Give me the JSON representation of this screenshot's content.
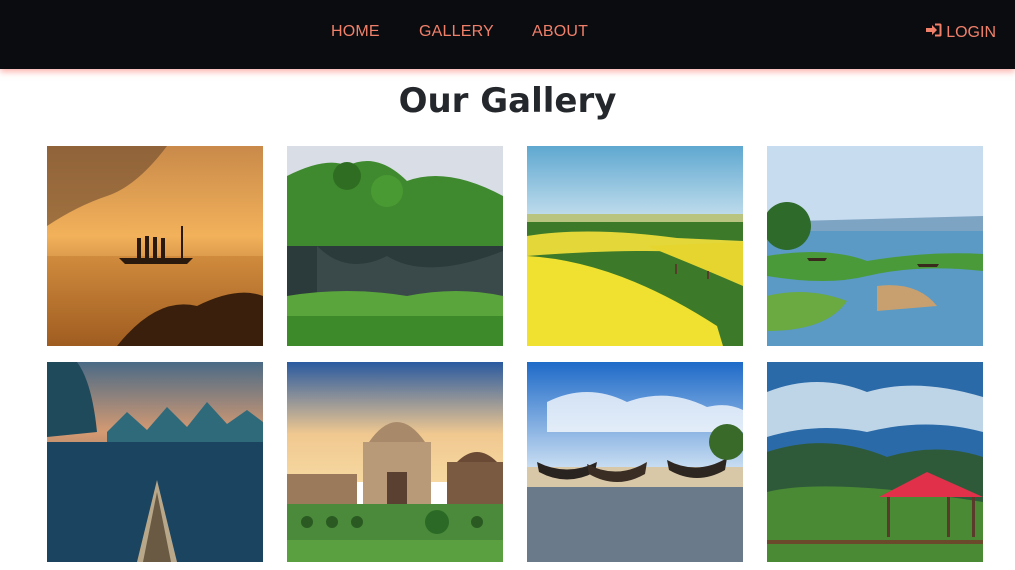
{
  "nav": {
    "links": [
      "HOME",
      "GALLERY",
      "ABOUT"
    ],
    "login_label": "LOGIN",
    "accent_color": "#f0806a",
    "background_color": "#0b0c10"
  },
  "gallery": {
    "title": "Our Gallery",
    "photos": [
      {
        "subject": "misty river with boatmen at sunrise"
      },
      {
        "subject": "green hills reflected in a pond"
      },
      {
        "subject": "yellow mustard fields"
      },
      {
        "subject": "lake with boats and green island"
      },
      {
        "subject": "boat bow on river among karst mountains"
      },
      {
        "subject": "domed mosque in garden"
      },
      {
        "subject": "wooden fishing boats on beach"
      },
      {
        "subject": "gazebo on hilltop above clouds"
      }
    ]
  }
}
